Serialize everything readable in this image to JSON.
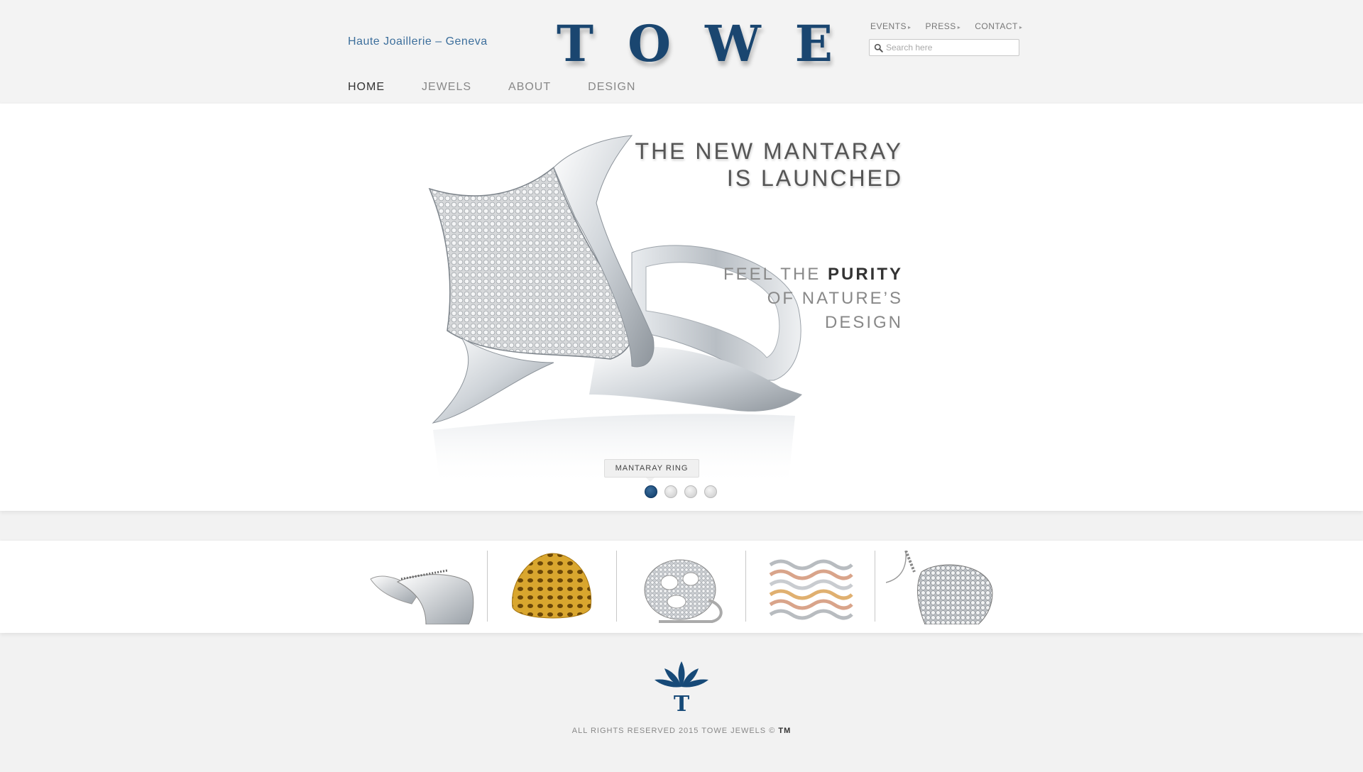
{
  "header": {
    "tagline": "Haute Joaillerie – Geneva",
    "logo_text": "TOWE",
    "top_links": [
      {
        "label": "EVENTS",
        "arrow": "▸"
      },
      {
        "label": "PRESS",
        "arrow": "▸"
      },
      {
        "label": "CONTACT",
        "arrow": "▸"
      }
    ],
    "search": {
      "placeholder": "Search here",
      "value": ""
    },
    "nav": [
      {
        "label": "HOME",
        "active": true
      },
      {
        "label": "JEWELS",
        "active": false
      },
      {
        "label": "ABOUT",
        "active": false
      },
      {
        "label": "DESIGN",
        "active": false
      }
    ]
  },
  "hero": {
    "headline_line1": "THE NEW MANTARAY",
    "headline_line2": "IS LAUNCHED",
    "sub_pre": "FEEL THE ",
    "sub_bold": "PURITY",
    "sub_line2": "OF NATURE’S",
    "sub_line3": "DESIGN",
    "caption": "MANTARAY RING",
    "slides_total": 4,
    "active_slide": 1
  },
  "thumbnails": [
    {
      "name": "mantaray-ring-thumbnail"
    },
    {
      "name": "gold-ring-thumbnail"
    },
    {
      "name": "openwork-diamond-ring-thumbnail"
    },
    {
      "name": "stacked-bands-thumbnail"
    },
    {
      "name": "heart-pendant-thumbnail"
    }
  ],
  "footer": {
    "copyright_text": "ALL RIGHTS RESERVED 2015 TOWE JEWELS © ",
    "tm": "TM"
  },
  "colors": {
    "brand_blue": "#1a4670",
    "tagline_blue": "#3d6f9c",
    "background": "#f2f2f2"
  }
}
